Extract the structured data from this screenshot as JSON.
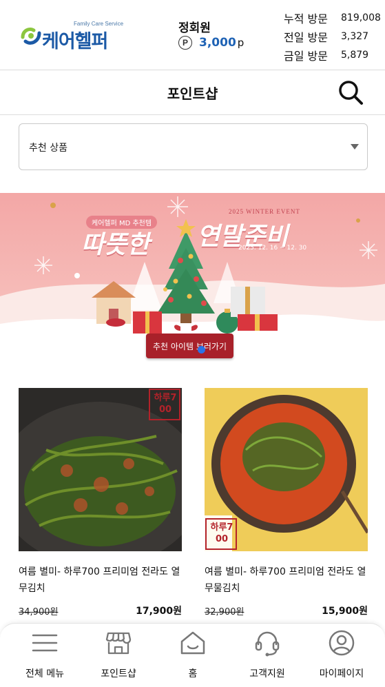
{
  "header": {
    "logo_sub": "Family Care Service",
    "logo_text": "케어헬퍼",
    "member_name": "정회원",
    "point_symbol": "P",
    "points": "3,000",
    "point_unit": "p",
    "stats": [
      {
        "label": "누적 방문",
        "value": "819,008"
      },
      {
        "label": "전일 방문",
        "value": "3,327"
      },
      {
        "label": "금일 방문",
        "value": "5,879"
      }
    ]
  },
  "page_title": "포인트샵",
  "filter": {
    "selected": "추천 상품"
  },
  "banner": {
    "top_tag": "케어헬퍼 MD 추천템",
    "event_name": "2025 WINTER EVENT",
    "headline_left": "따뜻한",
    "headline_right": "연말준비",
    "dates": "2025. 12. 16 ~ 12. 30",
    "cta": "추천 아이템 보러가기"
  },
  "products": [
    {
      "name": "여름 별미- 하루700 프리미엄 전라도 열무김치",
      "stamp": "하루700",
      "old_price": "34,900원",
      "price": "17,900원"
    },
    {
      "name": "여름 별미- 하루700 프리미엄 전라도 열무물김치",
      "stamp": "하루700",
      "old_price": "32,900원",
      "price": "15,900원"
    }
  ],
  "bottom_nav": [
    {
      "label": "전체 메뉴",
      "icon": "menu-icon"
    },
    {
      "label": "포인트샵",
      "icon": "store-icon"
    },
    {
      "label": "홈",
      "icon": "home-icon"
    },
    {
      "label": "고객지원",
      "icon": "headset-icon"
    },
    {
      "label": "마이페이지",
      "icon": "user-icon"
    }
  ],
  "colors": {
    "brand_blue": "#1f63b5",
    "logo_green": "#8cc63f",
    "banner_pink": "#f4b0ad",
    "dot_blue": "#2a73e8"
  }
}
